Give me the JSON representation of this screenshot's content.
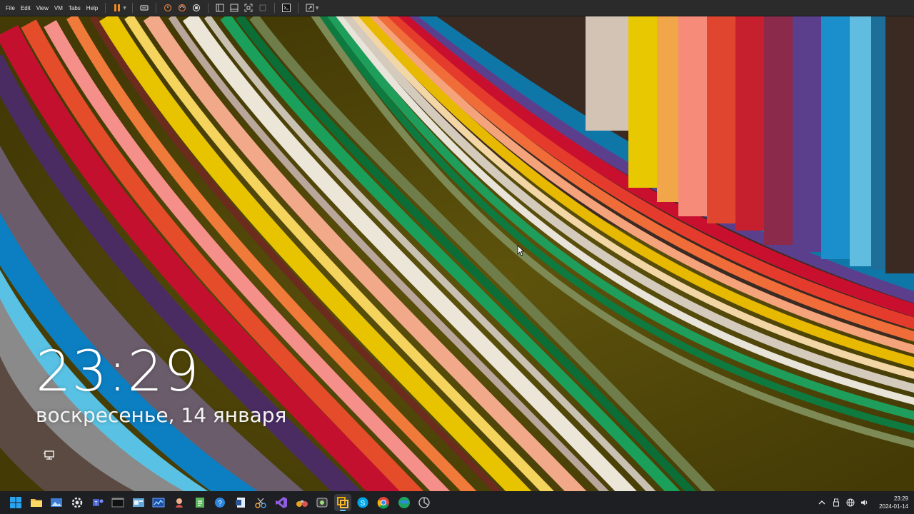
{
  "toolbar": {
    "menu": [
      "File",
      "Edit",
      "View",
      "VM",
      "Tabs",
      "Help"
    ],
    "icons": [
      "pause-icon",
      "send-ctrl-alt-del-icon",
      "snapshot-icon",
      "revert-snapshot-icon",
      "snapshot-manager-icon",
      "library-icon",
      "console-view-icon",
      "fullscreen-icon",
      "unity-icon",
      "terminal-icon",
      "stretch-icon"
    ]
  },
  "lock_screen": {
    "time": "23:29",
    "date": "воскресенье, 14 января"
  },
  "taskbar": {
    "apps": [
      "start-icon",
      "file-explorer-icon",
      "photos-icon",
      "settings-icon",
      "teams-icon",
      "terminal-icon",
      "control-panel-icon",
      "task-manager-icon",
      "paint-icon",
      "notepad-icon",
      "help-icon",
      "word-icon",
      "snipping-icon",
      "visual-studio-icon",
      "binoculars-icon",
      "xbox-icon",
      "vmware-icon",
      "skype-icon",
      "chrome-icon",
      "edge-icon",
      "system-icon"
    ],
    "active_app": "vmware-icon"
  },
  "tray": {
    "icons": [
      "chevron-up-icon",
      "usb-icon",
      "network-icon",
      "volume-icon"
    ],
    "time": "23:29",
    "date": "2024-01-14"
  },
  "colors": {
    "toolbar_bg": "#2b2b2b",
    "taskbar_bg": "#1e1f22",
    "olive_band": "#5a4f0a",
    "accent": "#60cdff"
  }
}
